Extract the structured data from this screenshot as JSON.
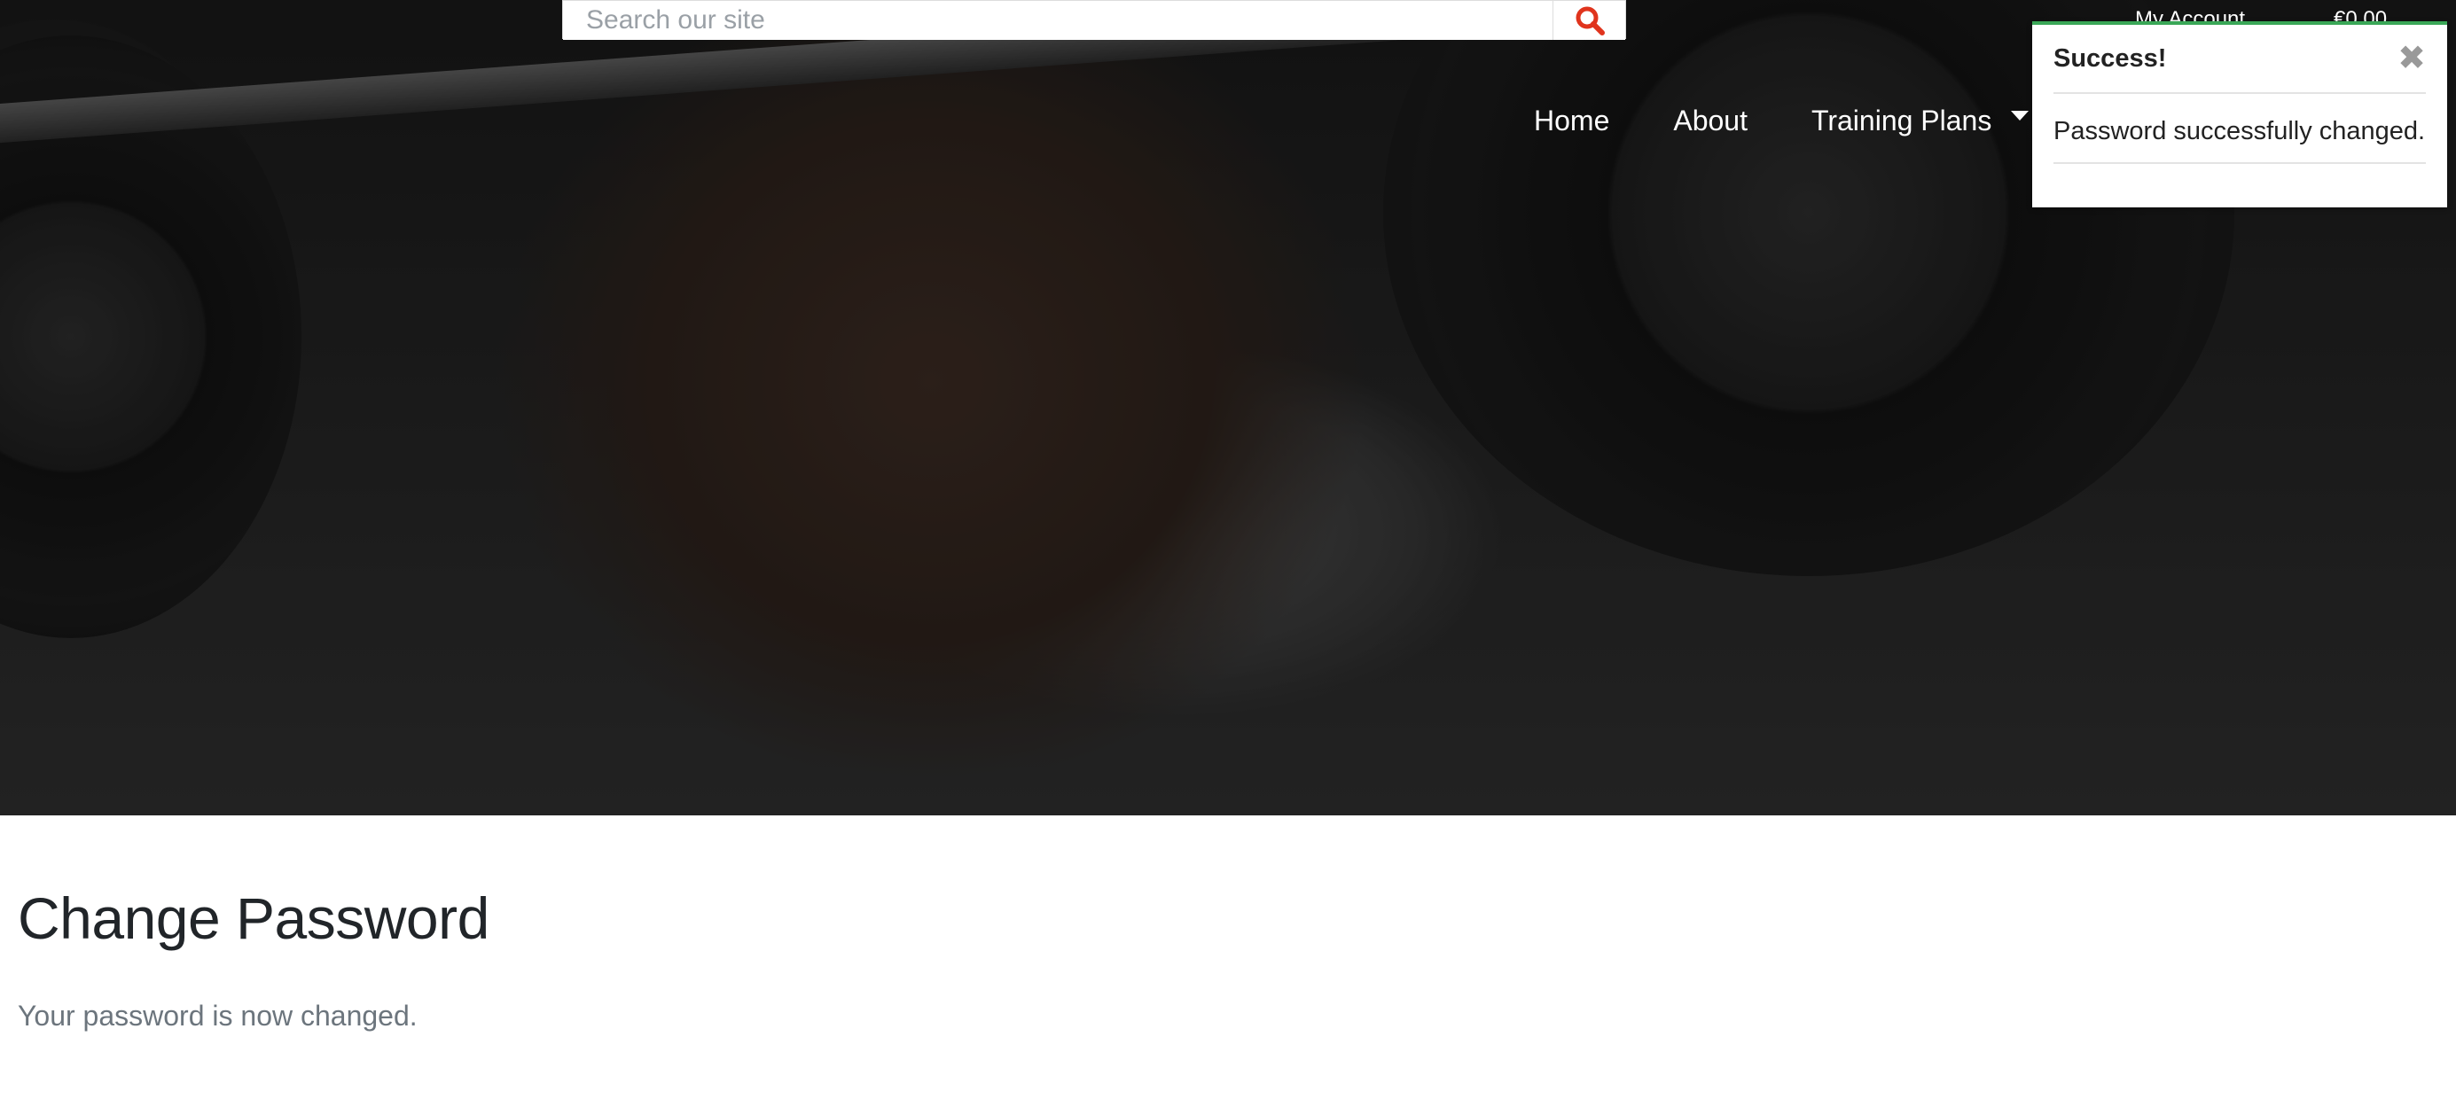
{
  "search": {
    "placeholder": "Search our site"
  },
  "header": {
    "account_label": "My Account",
    "cart_total": "€0.00"
  },
  "nav": {
    "items": [
      {
        "label": "Home"
      },
      {
        "label": "About"
      },
      {
        "label": "Training Plans"
      }
    ]
  },
  "toast": {
    "title": "Success!",
    "close": "✖",
    "message": "Password successfully changed."
  },
  "main": {
    "title": "Change Password",
    "message": "Your password is now changed."
  },
  "colors": {
    "accent_red": "#e0341d",
    "success_green": "#3aa757"
  }
}
